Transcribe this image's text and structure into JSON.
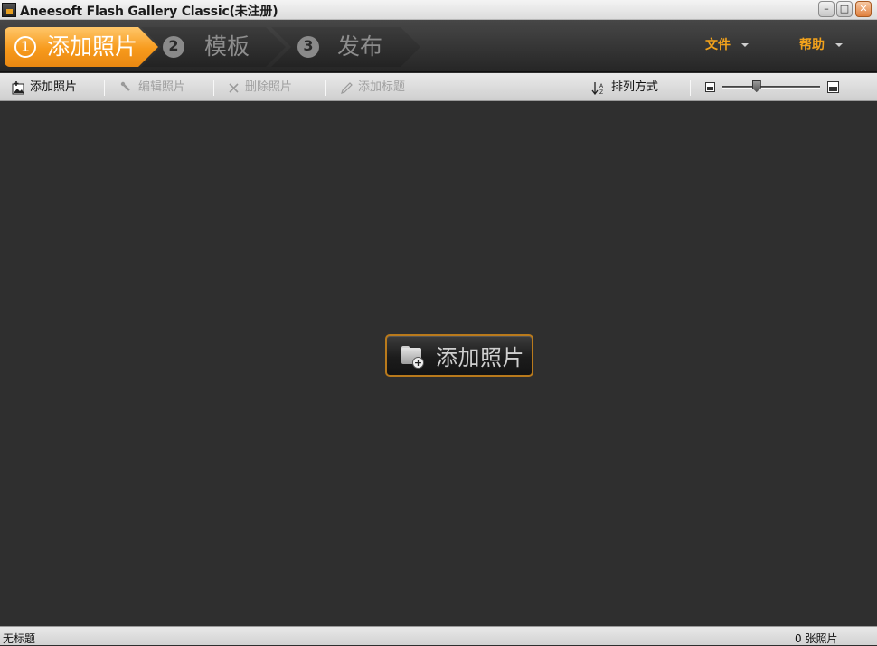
{
  "window": {
    "title": "Aneesoft Flash Gallery Classic(未注册)",
    "controls": {
      "minimize": "–",
      "maximize": "□",
      "close": "✕"
    }
  },
  "steps": [
    {
      "number": "1",
      "label": "添加照片",
      "active": true
    },
    {
      "number": "2",
      "label": "模板",
      "active": false
    },
    {
      "number": "3",
      "label": "发布",
      "active": false
    }
  ],
  "menus": {
    "file": "文件",
    "help": "帮助"
  },
  "toolbar": {
    "add_photos": "添加照片",
    "edit_photos": "编辑照片",
    "delete_photos": "删除照片",
    "add_title": "添加标题",
    "sort_by": "排列方式",
    "thumbnail_size_level": 0.35
  },
  "main": {
    "add_photos_button": "添加照片"
  },
  "status": {
    "project_name": "无标题",
    "photo_count": "0 张照片"
  },
  "colors": {
    "accent": "#f79a1c",
    "menu_text": "#f2a21c",
    "main_bg": "#2f2f2f"
  },
  "icons": {
    "add_photos": "picture-icon",
    "edit_photos": "wrench-icon",
    "delete_photos": "x-icon",
    "add_title": "pencil-icon",
    "sort_by": "sort-icon",
    "center_button": "folder-plus-icon"
  }
}
